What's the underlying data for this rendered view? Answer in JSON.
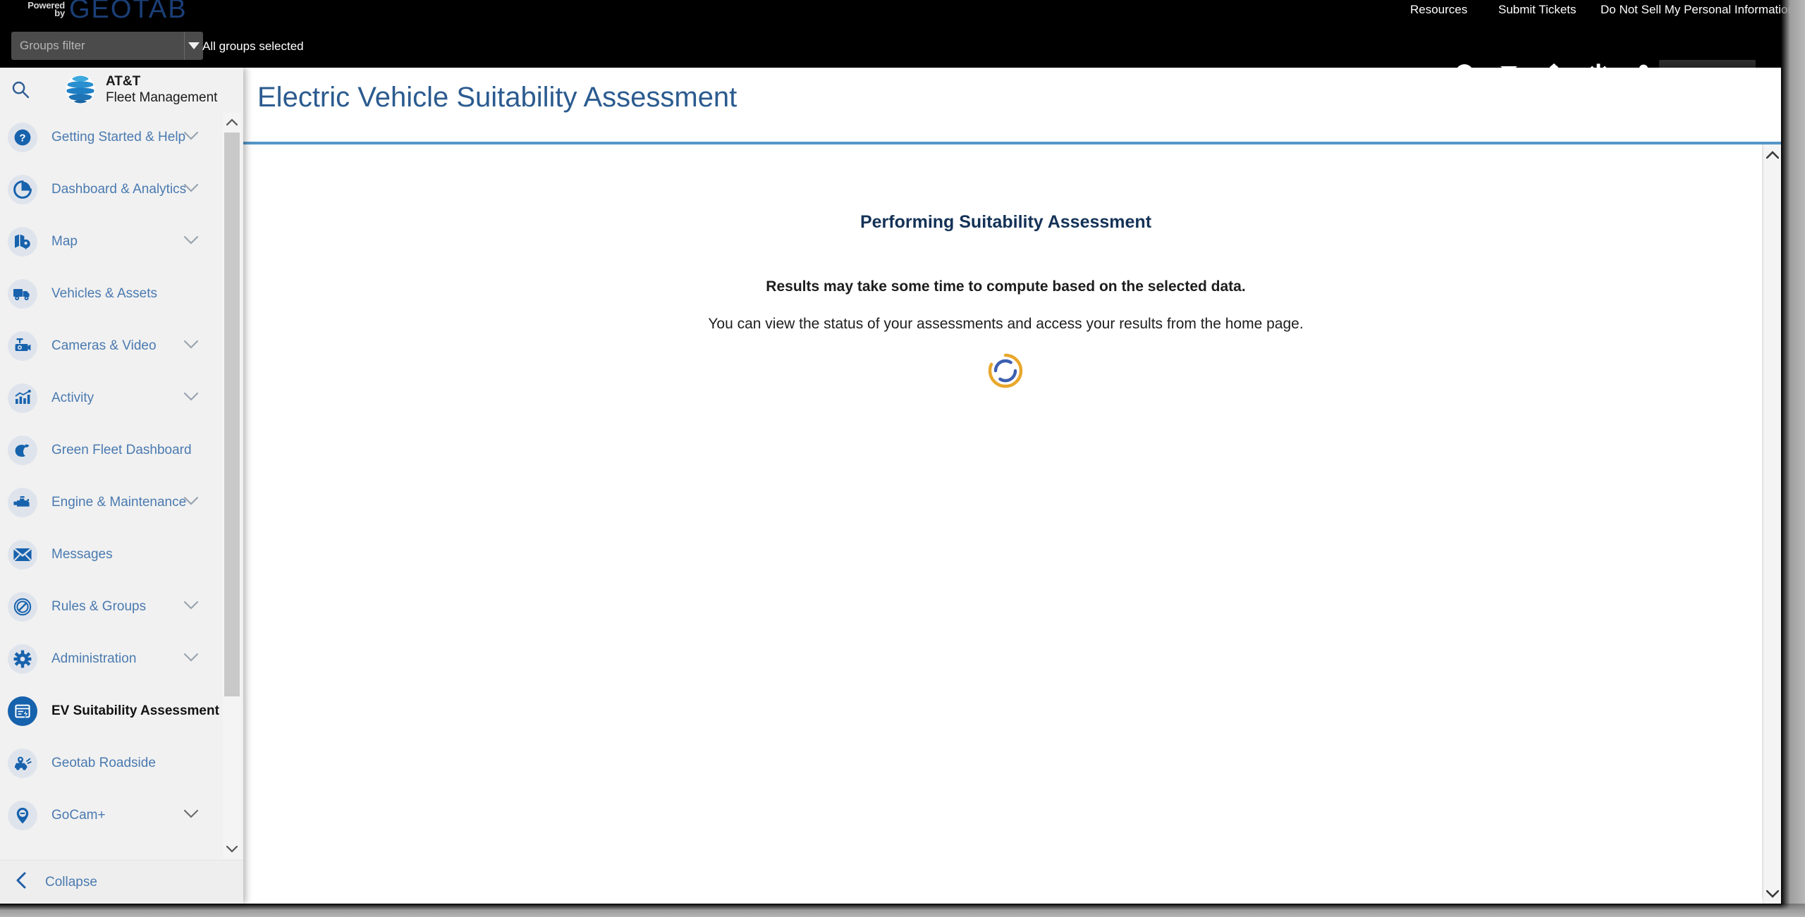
{
  "header": {
    "powered_by_line1": "Powered",
    "powered_by_line2": "by",
    "brand": "GEOTAB",
    "links": [
      {
        "label": "Resources",
        "name": "resources"
      },
      {
        "label": "Submit Tickets",
        "name": "submit-tickets"
      },
      {
        "label": "Do Not Sell My Personal Information",
        "name": "do-not-sell"
      }
    ],
    "icons": [
      {
        "name": "help-icon"
      },
      {
        "name": "mail-icon"
      },
      {
        "name": "notifications-bell-icon"
      },
      {
        "name": "gear-icon"
      },
      {
        "name": "user-account-icon"
      }
    ]
  },
  "groups_bar": {
    "filter_placeholder": "Groups filter",
    "filter_value": "",
    "selected_summary": "All groups selected"
  },
  "sidebar": {
    "search_icon": "search-icon",
    "logo": {
      "name": "att-fleet-management-logo",
      "line1": "AT&T",
      "line2": "Fleet Management"
    },
    "items": [
      {
        "label": "Getting Started & Help",
        "icon": "question-circle-icon",
        "expandable": true,
        "active": false
      },
      {
        "label": "Dashboard & Analytics",
        "icon": "pie-chart-icon",
        "expandable": true,
        "active": false
      },
      {
        "label": "Map",
        "icon": "map-pin-icon",
        "expandable": true,
        "active": false
      },
      {
        "label": "Vehicles & Assets",
        "icon": "truck-icon",
        "expandable": false,
        "active": false
      },
      {
        "label": "Cameras & Video",
        "icon": "dashcam-icon",
        "expandable": true,
        "active": false
      },
      {
        "label": "Activity",
        "icon": "bar-chart-icon",
        "expandable": true,
        "active": false
      },
      {
        "label": "Green Fleet Dashboard",
        "icon": "leaf-icon",
        "expandable": false,
        "active": false
      },
      {
        "label": "Engine & Maintenance",
        "icon": "engine-icon",
        "expandable": true,
        "active": false
      },
      {
        "label": "Messages",
        "icon": "envelope-icon",
        "expandable": false,
        "active": false
      },
      {
        "label": "Rules & Groups",
        "icon": "prohibited-sign-icon",
        "expandable": true,
        "active": false
      },
      {
        "label": "Administration",
        "icon": "gear-icon",
        "expandable": true,
        "active": false
      },
      {
        "label": "EV Suitability Assessment",
        "icon": "ev-assessment-icon",
        "expandable": false,
        "active": true
      },
      {
        "label": "Geotab Roadside",
        "icon": "roadside-assist-icon",
        "expandable": false,
        "active": false
      },
      {
        "label": "GoCam+",
        "icon": "gocam-pin-icon",
        "expandable": true,
        "active": false
      }
    ],
    "collapse_label": "Collapse",
    "collapse_icon": "chevron-left-icon"
  },
  "main": {
    "page_title": "Electric Vehicle Suitability Assessment",
    "status_heading": "Performing Suitability Assessment",
    "status_line_1": "Results may take some time to compute based on the selected data.",
    "status_line_2": "You can view the status of your assessments and access your results from the home page.",
    "spinner": {
      "name": "loading-spinner",
      "outer_color": "#e8a72c",
      "inner_color": "#3c5fb0"
    }
  },
  "colors": {
    "utility_bar_bg": "#000000",
    "sidebar_bg": "#f1f1f1",
    "nav_link": "#4a7ab0",
    "nav_active_bg": "#1762ad",
    "title_blue": "#2b5b8f",
    "divider_blue": "#5596c8",
    "geotab_blue": "#1b3f77"
  }
}
